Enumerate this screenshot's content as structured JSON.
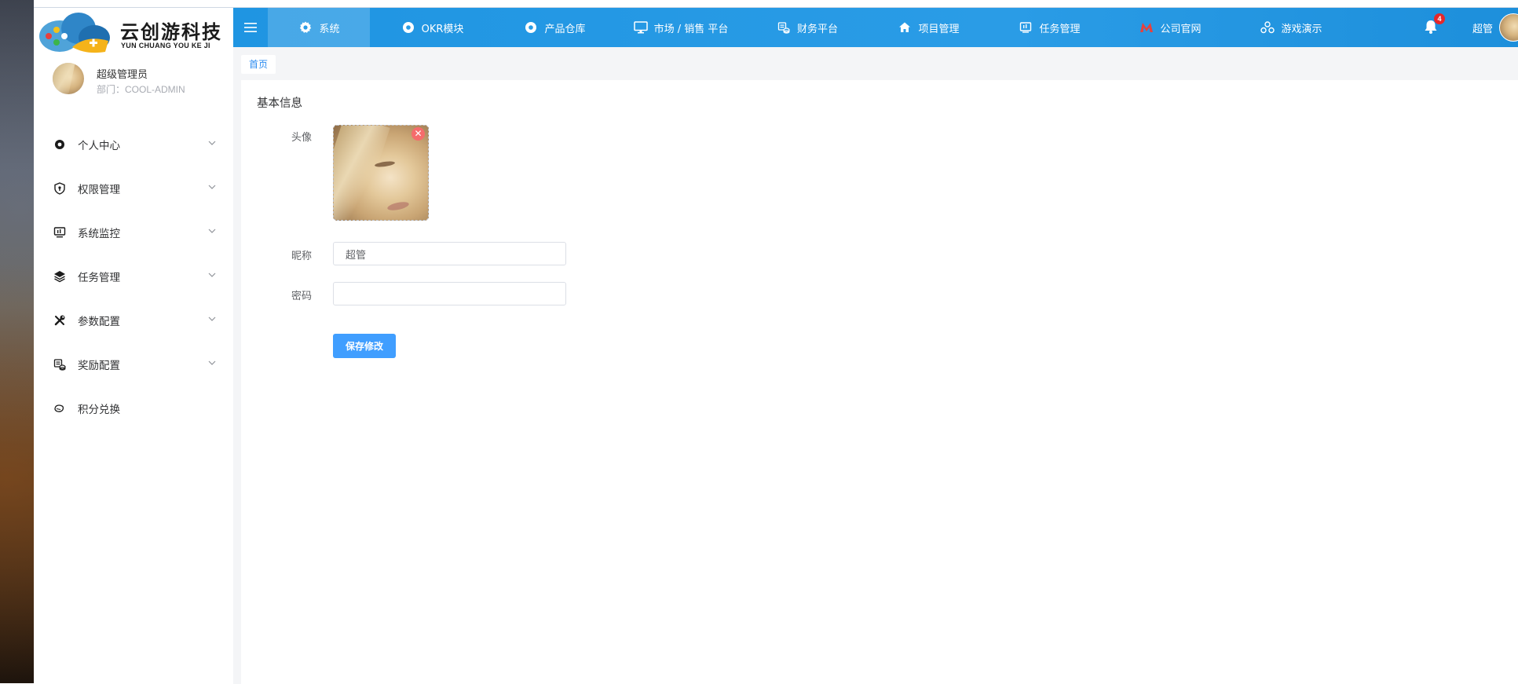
{
  "brand": {
    "name_cn": "云创游科技",
    "name_en": "YUN CHUANG YOU KE JI"
  },
  "user": {
    "name": "超级管理员",
    "dept": "部门：COOL-ADMIN"
  },
  "sidebar": {
    "items": [
      {
        "label": "个人中心",
        "icon": "record-icon",
        "expandable": true
      },
      {
        "label": "权限管理",
        "icon": "shield-icon",
        "expandable": true
      },
      {
        "label": "系统监控",
        "icon": "monitor-icon",
        "expandable": true
      },
      {
        "label": "任务管理",
        "icon": "layers-icon",
        "expandable": true
      },
      {
        "label": "参数配置",
        "icon": "tools-icon",
        "expandable": true
      },
      {
        "label": "奖励配置",
        "icon": "coins-icon",
        "expandable": true
      },
      {
        "label": "积分兑换",
        "icon": "leaf-icon",
        "expandable": false
      }
    ]
  },
  "topnav": {
    "items": [
      {
        "label": "系统",
        "icon": "gear-icon",
        "active": true
      },
      {
        "label": "OKR模块",
        "icon": "record-icon",
        "active": false
      },
      {
        "label": "产品仓库",
        "icon": "record-icon",
        "active": false
      },
      {
        "label": "市场 / 销售 平台",
        "icon": "desktop-icon",
        "active": false
      },
      {
        "label": "财务平台",
        "icon": "coins-icon",
        "active": false
      },
      {
        "label": "项目管理",
        "icon": "home-icon",
        "active": false
      },
      {
        "label": "任务管理",
        "icon": "board-icon",
        "active": false
      },
      {
        "label": "公司官网",
        "icon": "m-logo-icon",
        "active": false
      },
      {
        "label": "游戏演示",
        "icon": "cluster-icon",
        "active": false
      }
    ],
    "notification_count": "4",
    "username": "超管"
  },
  "breadcrumb": {
    "home": "首页"
  },
  "profile_form": {
    "title": "基本信息",
    "avatar_label": "头像",
    "nickname_label": "昵称",
    "nickname_value": "超管",
    "password_label": "密码",
    "password_value": "",
    "save_label": "保存修改"
  },
  "colors": {
    "topbar": "#1f95e2",
    "primary_button": "#409eff",
    "remove_button": "#f56c6c",
    "badge": "#e5272a",
    "breadcrumb_link": "#2d8cf0"
  }
}
